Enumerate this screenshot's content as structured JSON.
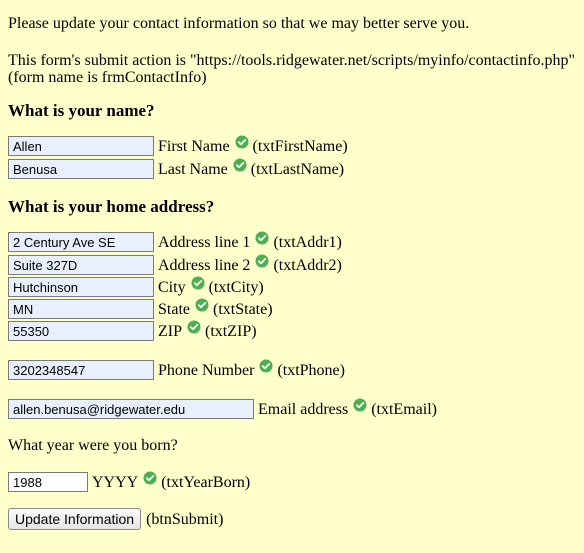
{
  "intro": "Please update your contact information so that we may better serve you.",
  "form_info": {
    "action_line": "This form's submit action is \"https://tools.ridgewater.net/scripts/myinfo/contactinfo.php\"",
    "name_line": "(form name is frmContactInfo)"
  },
  "name_section": {
    "heading": "What is your name?",
    "first": {
      "value": "Allen",
      "label": "First Name",
      "id_note": "(txtFirstName)"
    },
    "last": {
      "value": "Benusa",
      "label": "Last Name",
      "id_note": "(txtLastName)"
    }
  },
  "address_section": {
    "heading": "What is your home address?",
    "addr1": {
      "value": "2 Century Ave SE",
      "label": "Address line 1",
      "id_note": "(txtAddr1)"
    },
    "addr2": {
      "value": "Suite 327D",
      "label": "Address line 2",
      "id_note": "(txtAddr2)"
    },
    "city": {
      "value": "Hutchinson",
      "label": "City",
      "id_note": "(txtCity)"
    },
    "state": {
      "value": "MN",
      "label": "State",
      "id_note": "(txtState)"
    },
    "zip": {
      "value": "55350",
      "label": "ZIP",
      "id_note": "(txtZIP)"
    }
  },
  "phone": {
    "value": "3202348547",
    "label": "Phone Number",
    "id_note": "(txtPhone)"
  },
  "email": {
    "value": "allen.benusa@ridgewater.edu",
    "label": "Email address",
    "id_note": "(txtEmail)"
  },
  "birth": {
    "question": "What year were you born?",
    "value": "1988",
    "label": "YYYY",
    "id_note": "(txtYearBorn)"
  },
  "submit": {
    "label": "Update Information",
    "id_note": "(btnSubmit)"
  },
  "icons": {
    "valid": "green-checkmark-icon"
  },
  "colors": {
    "background": "#ffffcc",
    "field_bg": "#e8f0fe",
    "valid_green": "#4caf50"
  }
}
